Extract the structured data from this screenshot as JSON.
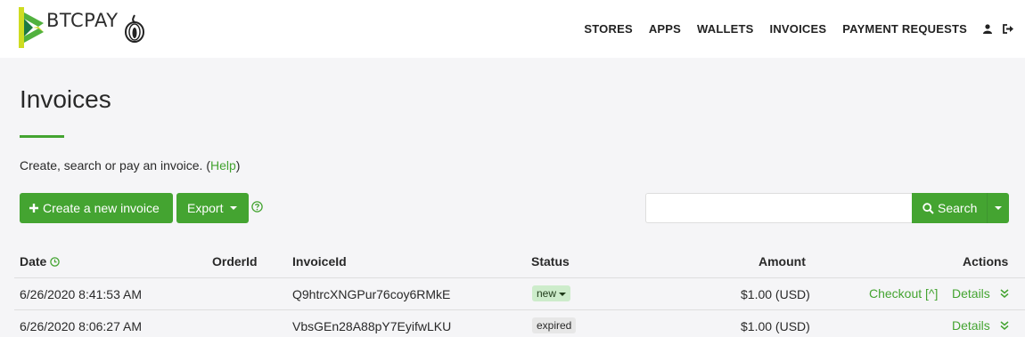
{
  "brand": {
    "name": "BTCPAY"
  },
  "nav": {
    "links": [
      "STORES",
      "APPS",
      "WALLETS",
      "INVOICES",
      "PAYMENT REQUESTS"
    ]
  },
  "page": {
    "title": "Invoices",
    "lead_text": "Create, search or pay an invoice. (",
    "lead_link": "Help",
    "lead_close": ")"
  },
  "toolbar": {
    "create_label": "Create a new invoice",
    "export_label": "Export",
    "search_label": "Search",
    "search_value": ""
  },
  "table": {
    "headers": {
      "date": "Date",
      "order": "OrderId",
      "invoice": "InvoiceId",
      "status": "Status",
      "amount": "Amount",
      "actions": "Actions"
    },
    "rows": [
      {
        "date": "6/26/2020 8:41:53 AM",
        "order": "",
        "invoice": "Q9htrcXNGPur76coy6RMkE",
        "status": "new",
        "amount": "$1.00 (USD)",
        "checkout": "Checkout [^]",
        "details": "Details"
      },
      {
        "date": "6/26/2020 8:06:27 AM",
        "order": "",
        "invoice": "VbsGEn28A88pY7EyifwLKU",
        "status": "expired",
        "amount": "$1.00 (USD)",
        "checkout": "",
        "details": "Details"
      }
    ]
  },
  "colors": {
    "accent": "#44a431",
    "background": "#f5f5f7"
  }
}
